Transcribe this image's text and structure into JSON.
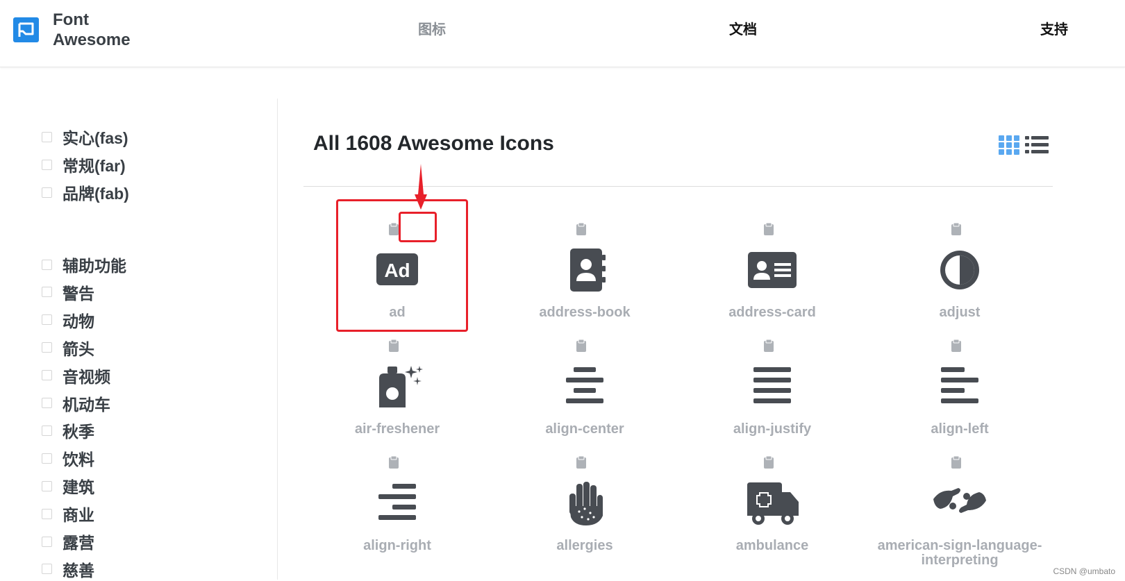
{
  "header": {
    "logo_text_line1": "Font",
    "logo_text_line2": "Awesome",
    "nav": {
      "icons": "图标",
      "docs": "文档",
      "support": "支持"
    }
  },
  "sidebar": {
    "styles": [
      "实心(fas)",
      "常规(far)",
      "品牌(fab)"
    ],
    "categories": [
      "辅助功能",
      "警告",
      "动物",
      "箭头",
      "音视频",
      "机动车",
      "秋季",
      "饮料",
      "建筑",
      "商业",
      "露营",
      "慈善"
    ]
  },
  "main": {
    "title": "All 1608 Awesome Icons",
    "view_modes": [
      "grid-view-icon",
      "list-view-icon"
    ],
    "active_view": "grid-view-icon",
    "icons": [
      {
        "name": "ad",
        "icon": "ad-icon"
      },
      {
        "name": "address-book",
        "icon": "address-book-icon"
      },
      {
        "name": "address-card",
        "icon": "address-card-icon"
      },
      {
        "name": "adjust",
        "icon": "adjust-icon"
      },
      {
        "name": "air-freshener",
        "icon": "air-freshener-icon"
      },
      {
        "name": "align-center",
        "icon": "align-center-icon"
      },
      {
        "name": "align-justify",
        "icon": "align-justify-icon"
      },
      {
        "name": "align-left",
        "icon": "align-left-icon"
      },
      {
        "name": "align-right",
        "icon": "align-right-icon"
      },
      {
        "name": "allergies",
        "icon": "allergies-icon"
      },
      {
        "name": "ambulance",
        "icon": "ambulance-icon"
      },
      {
        "name": "american-sign-language-interpreting",
        "icon": "american-sign-language-interpreting-icon"
      }
    ]
  },
  "watermark": "CSDN @umbato",
  "colors": {
    "accent": "#228ae6",
    "icon": "#484c52",
    "muted": "#a9adb3",
    "highlight": "#e8202a"
  }
}
